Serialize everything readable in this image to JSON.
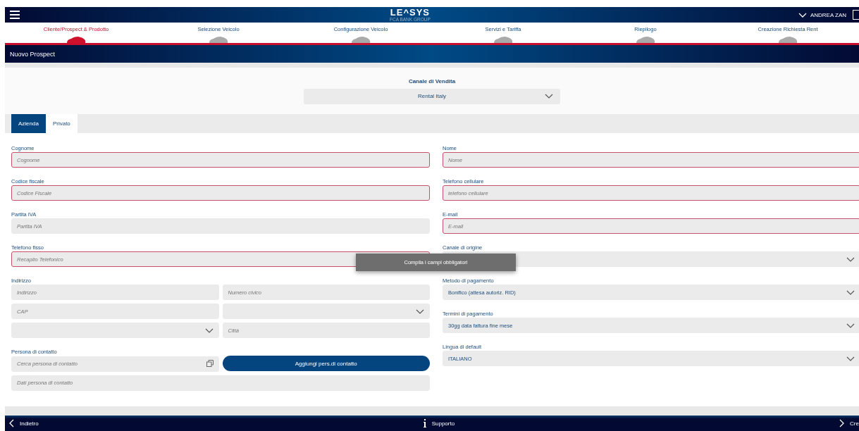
{
  "header": {
    "logo": "LE^SYS",
    "logo_sub": "FCA BANK GROUP",
    "user": "ANDREA ZAN"
  },
  "steps": [
    {
      "label": "Cliente/Prospect & Prodotto",
      "selected": true
    },
    {
      "label": "Selezione Veicolo",
      "selected": false
    },
    {
      "label": "Configurazione Veicolo",
      "selected": false
    },
    {
      "label": "Servizi e Tariffa",
      "selected": false
    },
    {
      "label": "Riepilogo",
      "selected": false
    },
    {
      "label": "Creazione Richiesta Rent",
      "selected": false
    }
  ],
  "title": "Nuovo Prospect",
  "channel": {
    "label": "Canale di Vendita",
    "value": "Rental Italy"
  },
  "tabs": [
    {
      "label": "Azienda",
      "selected": true
    },
    {
      "label": "Privato",
      "selected": false
    }
  ],
  "left_fields": [
    {
      "label": "Cognome",
      "placeholder": "Cognome",
      "required": true
    },
    {
      "label": "Codice fiscale",
      "placeholder": "Codice Fiscale",
      "required": true
    },
    {
      "label": "Partita IVA",
      "placeholder": "Partita IVA",
      "required": false
    },
    {
      "label": "Telefono fisso",
      "placeholder": "Recapito Telefonico",
      "required": true
    }
  ],
  "address": {
    "label": "Indirizzo",
    "fields": [
      {
        "kind": "input",
        "placeholder": "Indirizzo"
      },
      {
        "kind": "input",
        "placeholder": "Numero civico"
      },
      {
        "kind": "input",
        "placeholder": "CAP"
      },
      {
        "kind": "select"
      },
      {
        "kind": "select"
      },
      {
        "kind": "input",
        "placeholder": "Città"
      }
    ]
  },
  "contact": {
    "label": "Persona di contatto",
    "search_placeholder": "Cerca persona di contatto",
    "add_button": "Aggiungi pers.di contatto",
    "details_placeholder": "Dati persona di contatto"
  },
  "right_fields": [
    {
      "kind": "input",
      "label": "Nome",
      "placeholder": "Nome",
      "required": true
    },
    {
      "kind": "input",
      "label": "Telefono cellulare",
      "placeholder": "telefono cellulare",
      "required": true
    },
    {
      "kind": "input",
      "label": "E-mail",
      "placeholder": "E-mail",
      "required": true
    },
    {
      "kind": "select",
      "label": "Canale di origine",
      "required": false
    },
    {
      "kind": "select",
      "label": "Metodo di pagamento",
      "value": "Bonifico (attesa autoriz. RID)",
      "required": false
    },
    {
      "kind": "select",
      "label": "Termini di pagamento",
      "value": "30gg data fattura fine mese",
      "required": false
    },
    {
      "kind": "select",
      "label": "Lingua di default",
      "value": "ITALIANO",
      "required": false
    }
  ],
  "toast": "Compila i campi obbligatori",
  "footer": {
    "back": "Indietro",
    "support": "Supporto",
    "next": "Cre"
  }
}
